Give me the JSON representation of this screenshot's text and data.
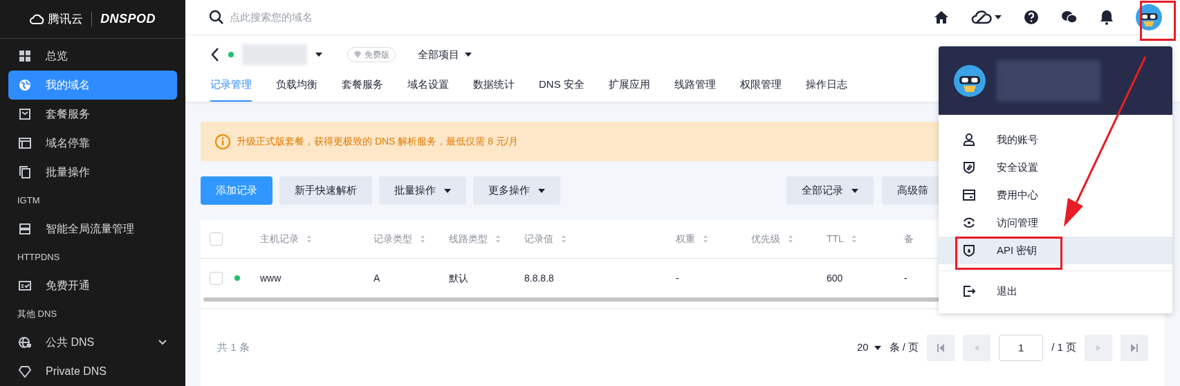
{
  "brand": {
    "cloud_name": "腾讯云",
    "product": "DNSPOD"
  },
  "sidebar": {
    "items": [
      {
        "kind": "item",
        "label": "总览",
        "selected": false
      },
      {
        "kind": "item",
        "label": "我的域名",
        "selected": true
      },
      {
        "kind": "item",
        "label": "套餐服务",
        "selected": false
      },
      {
        "kind": "item",
        "label": "域名停靠",
        "selected": false
      },
      {
        "kind": "item",
        "label": "批量操作",
        "selected": false
      },
      {
        "kind": "section",
        "label": "IGTM"
      },
      {
        "kind": "item",
        "label": "智能全局流量管理",
        "selected": false
      },
      {
        "kind": "section",
        "label": "HTTPDNS"
      },
      {
        "kind": "item",
        "label": "免费开通",
        "selected": false
      },
      {
        "kind": "section",
        "label": "其他 DNS"
      },
      {
        "kind": "item",
        "label": "公共 DNS",
        "selected": false,
        "expanded": false
      },
      {
        "kind": "item",
        "label": "Private DNS",
        "selected": false
      }
    ]
  },
  "search": {
    "placeholder": "点此搜索您的域名"
  },
  "domain": {
    "badge": "免费版",
    "project": "全部项目"
  },
  "tabs": [
    {
      "label": "记录管理",
      "selected": true
    },
    {
      "label": "负载均衡",
      "selected": false
    },
    {
      "label": "套餐服务",
      "selected": false
    },
    {
      "label": "域名设置",
      "selected": false
    },
    {
      "label": "数据统计",
      "selected": false
    },
    {
      "label": "DNS 安全",
      "selected": false
    },
    {
      "label": "扩展应用",
      "selected": false
    },
    {
      "label": "线路管理",
      "selected": false
    },
    {
      "label": "权限管理",
      "selected": false
    },
    {
      "label": "操作日志",
      "selected": false
    }
  ],
  "notice": "升级正式版套餐，获得更极致的 DNS 解析服务，最低仅需 8 元/月",
  "toolbar": [
    {
      "label": "添加记录",
      "kind": "primary"
    },
    {
      "label": "新手快速解析",
      "kind": "plain"
    },
    {
      "label": "批量操作",
      "kind": "dropdown"
    },
    {
      "label": "更多操作",
      "kind": "dropdown"
    }
  ],
  "filters": [
    {
      "label": "全部记录",
      "kind": "dropdown"
    },
    {
      "label": "高级筛",
      "kind": "plain"
    }
  ],
  "table": {
    "all_checked": false,
    "columns": [
      "主机记录",
      "记录类型",
      "线路类型",
      "记录值",
      "权重",
      "优先级",
      "TTL",
      "备"
    ],
    "rows": [
      {
        "checked": false,
        "enabled": true,
        "cells": [
          "www",
          "A",
          "默认",
          "8.8.8.8",
          "-",
          "",
          "600",
          "-"
        ]
      }
    ]
  },
  "pagination": {
    "total": "共 1 条",
    "page_size": "20",
    "per_page": "条 / 页",
    "page": "1",
    "pages": "/ 1 页"
  },
  "user_menu": {
    "items": [
      {
        "label": "我的账号",
        "selected": false
      },
      {
        "label": "安全设置",
        "selected": false
      },
      {
        "label": "费用中心",
        "selected": false
      },
      {
        "label": "访问管理",
        "selected": false
      },
      {
        "label": "API 密钥",
        "selected": true
      },
      {
        "label": "退出",
        "selected": false
      }
    ]
  }
}
